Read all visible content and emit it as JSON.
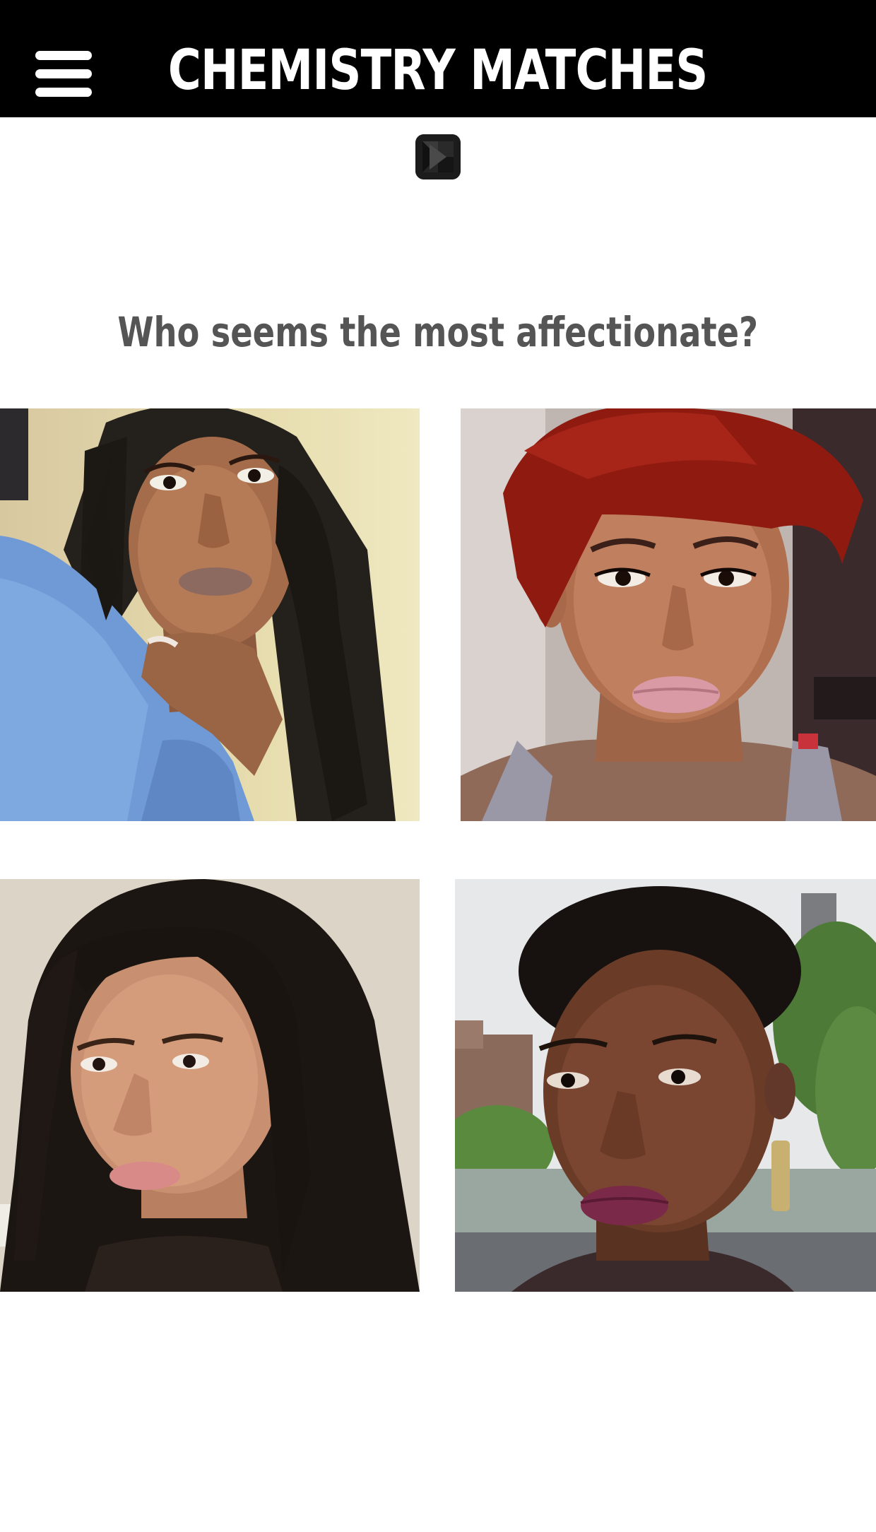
{
  "header": {
    "title": "CHEMISTRY MATCHES",
    "menu_icon": "hamburger-menu-icon",
    "background": "#000000",
    "text_color": "#ffffff"
  },
  "logo": {
    "icon": "gem-logo-icon"
  },
  "question": {
    "text": "Who seems the most affectionate?",
    "color": "#555555"
  },
  "photos": [
    {
      "name": "photo-option-1",
      "subject": "woman with long box braids in a blue t-shirt"
    },
    {
      "name": "photo-option-2",
      "subject": "woman with short red pixie haircut"
    },
    {
      "name": "photo-option-3",
      "subject": "woman with long straight dark hair"
    },
    {
      "name": "photo-option-4",
      "subject": "woman with short natural hair and purple lipstick outdoors"
    }
  ]
}
